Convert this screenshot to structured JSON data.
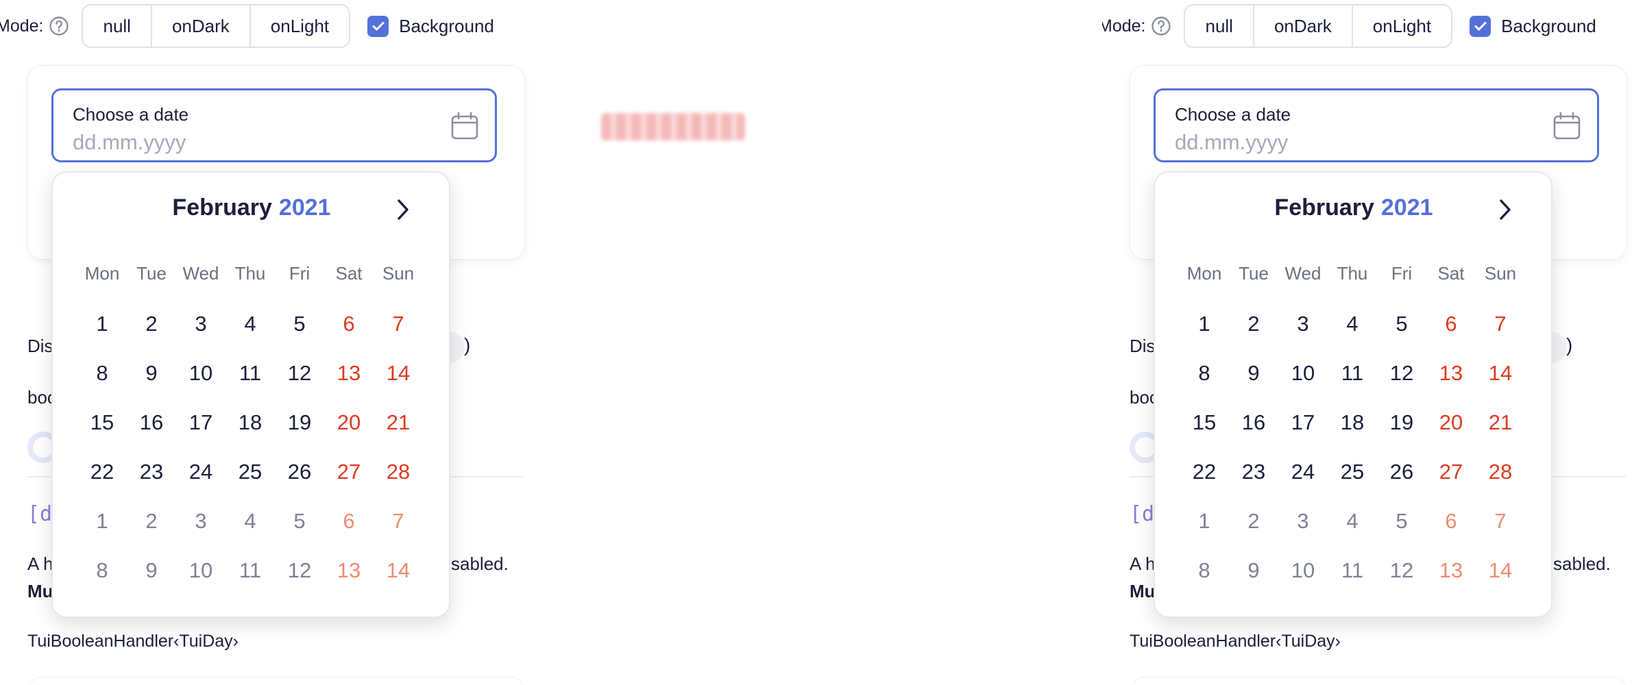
{
  "mode_label": "Mode:",
  "mode_options": [
    "null",
    "onDark",
    "onLight"
  ],
  "background": {
    "label": "Background",
    "checked": true
  },
  "date_input": {
    "label": "Choose a date",
    "placeholder": "dd.mm.yyyy"
  },
  "calendar": {
    "month": "February",
    "year": "2021",
    "weekdays": [
      "Mon",
      "Tue",
      "Wed",
      "Thu",
      "Fri",
      "Sat",
      "Sun"
    ],
    "days": [
      {
        "d": "1"
      },
      {
        "d": "2"
      },
      {
        "d": "3"
      },
      {
        "d": "4"
      },
      {
        "d": "5"
      },
      {
        "d": "6",
        "weekend": true
      },
      {
        "d": "7",
        "weekend": true
      },
      {
        "d": "8"
      },
      {
        "d": "9"
      },
      {
        "d": "10"
      },
      {
        "d": "11"
      },
      {
        "d": "12"
      },
      {
        "d": "13",
        "weekend": true
      },
      {
        "d": "14",
        "weekend": true
      },
      {
        "d": "15"
      },
      {
        "d": "16"
      },
      {
        "d": "17"
      },
      {
        "d": "18"
      },
      {
        "d": "19"
      },
      {
        "d": "20",
        "weekend": true
      },
      {
        "d": "21",
        "weekend": true
      },
      {
        "d": "22"
      },
      {
        "d": "23"
      },
      {
        "d": "24"
      },
      {
        "d": "25"
      },
      {
        "d": "26"
      },
      {
        "d": "27",
        "weekend": true
      },
      {
        "d": "28",
        "weekend": true
      },
      {
        "d": "1",
        "other": true
      },
      {
        "d": "2",
        "other": true
      },
      {
        "d": "3",
        "other": true
      },
      {
        "d": "4",
        "other": true
      },
      {
        "d": "5",
        "other": true
      },
      {
        "d": "6",
        "other": true,
        "weekend": true
      },
      {
        "d": "7",
        "other": true,
        "weekend": true
      },
      {
        "d": "8",
        "other": true
      },
      {
        "d": "9",
        "other": true
      },
      {
        "d": "10",
        "other": true
      },
      {
        "d": "11",
        "other": true
      },
      {
        "d": "12",
        "other": true
      },
      {
        "d": "13",
        "other": true,
        "weekend": true
      },
      {
        "d": "14",
        "other": true,
        "weekend": true
      }
    ]
  },
  "page": {
    "dis_fragment": "Dis",
    "paren": ")",
    "boo_fragment": "boo",
    "attr_fragment": "[d",
    "desc_start": "A h",
    "desc_end": "sabled.",
    "mu_fragment": "Mu",
    "handler_type": "TuiBooleanHandler‹TuiDay›"
  },
  "colors": {
    "accent": "#5471d9",
    "weekend": "#e0391f",
    "text": "#1b1f3b",
    "muted": "#a5a9ba"
  },
  "icons": {
    "help": "help-circle-icon",
    "calendar": "calendar-icon",
    "next": "chevron-right-icon",
    "check": "check-icon"
  }
}
